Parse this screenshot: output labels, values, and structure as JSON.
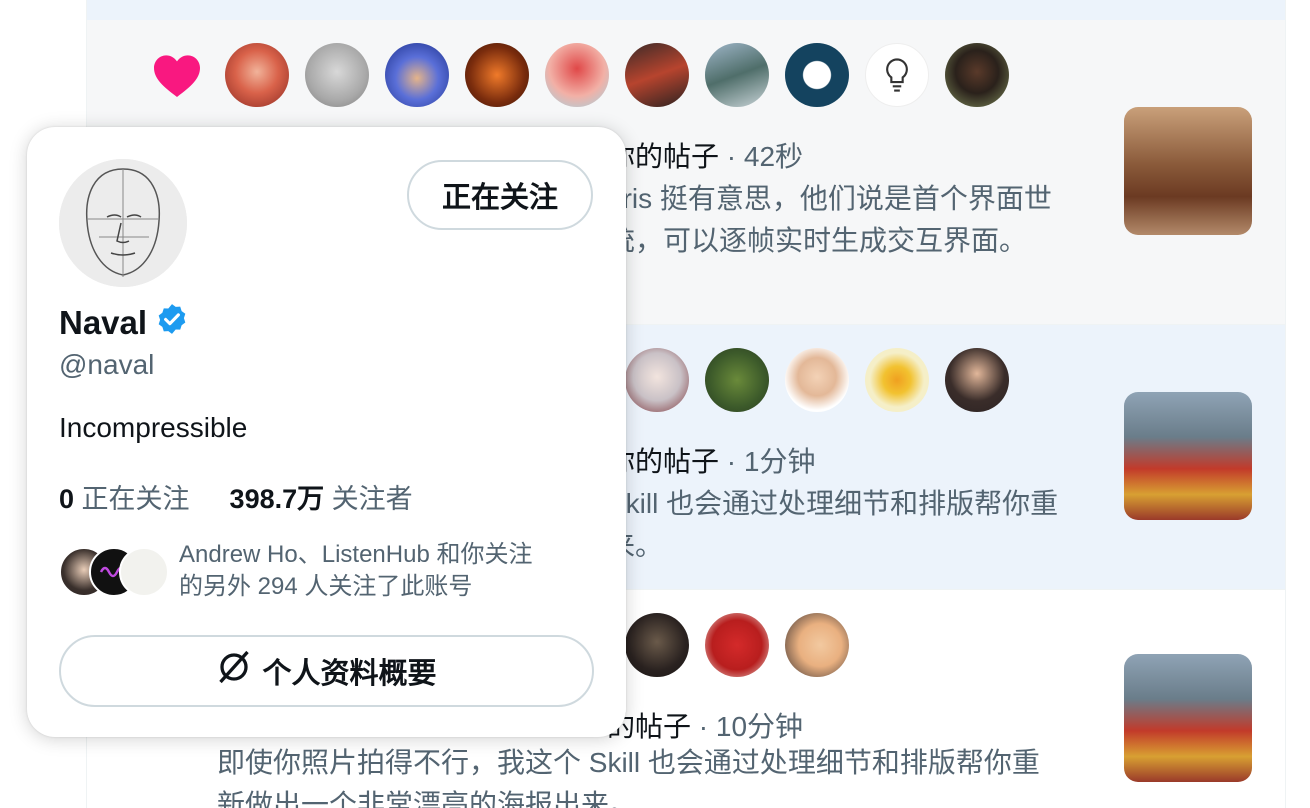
{
  "notifications": [
    {
      "title_suffix": "你的帖子",
      "time": "· 42秒",
      "body_line1": "aris 挺有意思，他们说是首个界面世",
      "body_line2": "统，可以逐帧实时生成交互界面。"
    },
    {
      "title_suffix": "你的帖子",
      "time": "· 1分钟",
      "body_line1": "Skill 也会通过处理细节和排版帮你重",
      "body_line2": "来。"
    },
    {
      "title_suffix": "的帖子",
      "time": "· 10分钟",
      "body_line1": "即使你照片拍得不行，我这个 Skill 也会通过处理细节和排版帮你重",
      "body_line2": "新做出一个非常漂亮的海报出来。"
    }
  ],
  "hover_card": {
    "follow_button": "正在关注",
    "name": "Naval",
    "handle": "@naval",
    "bio": "Incompressible",
    "following_count": "0",
    "following_label": "正在关注",
    "followers_count": "398.7万",
    "followers_label": "关注者",
    "mutual_text_line1": "Andrew Ho、ListenHub 和你关注",
    "mutual_text_line2": "的另外 294 人关注了此账号",
    "profile_summary_button": "个人资料概要"
  },
  "colors": {
    "like_heart": "#f91880",
    "verified": "#1d9bf0",
    "highlight_bg": "#ecf3fb"
  },
  "icons": [
    "heart-icon",
    "verified-badge-icon",
    "grok-icon"
  ]
}
